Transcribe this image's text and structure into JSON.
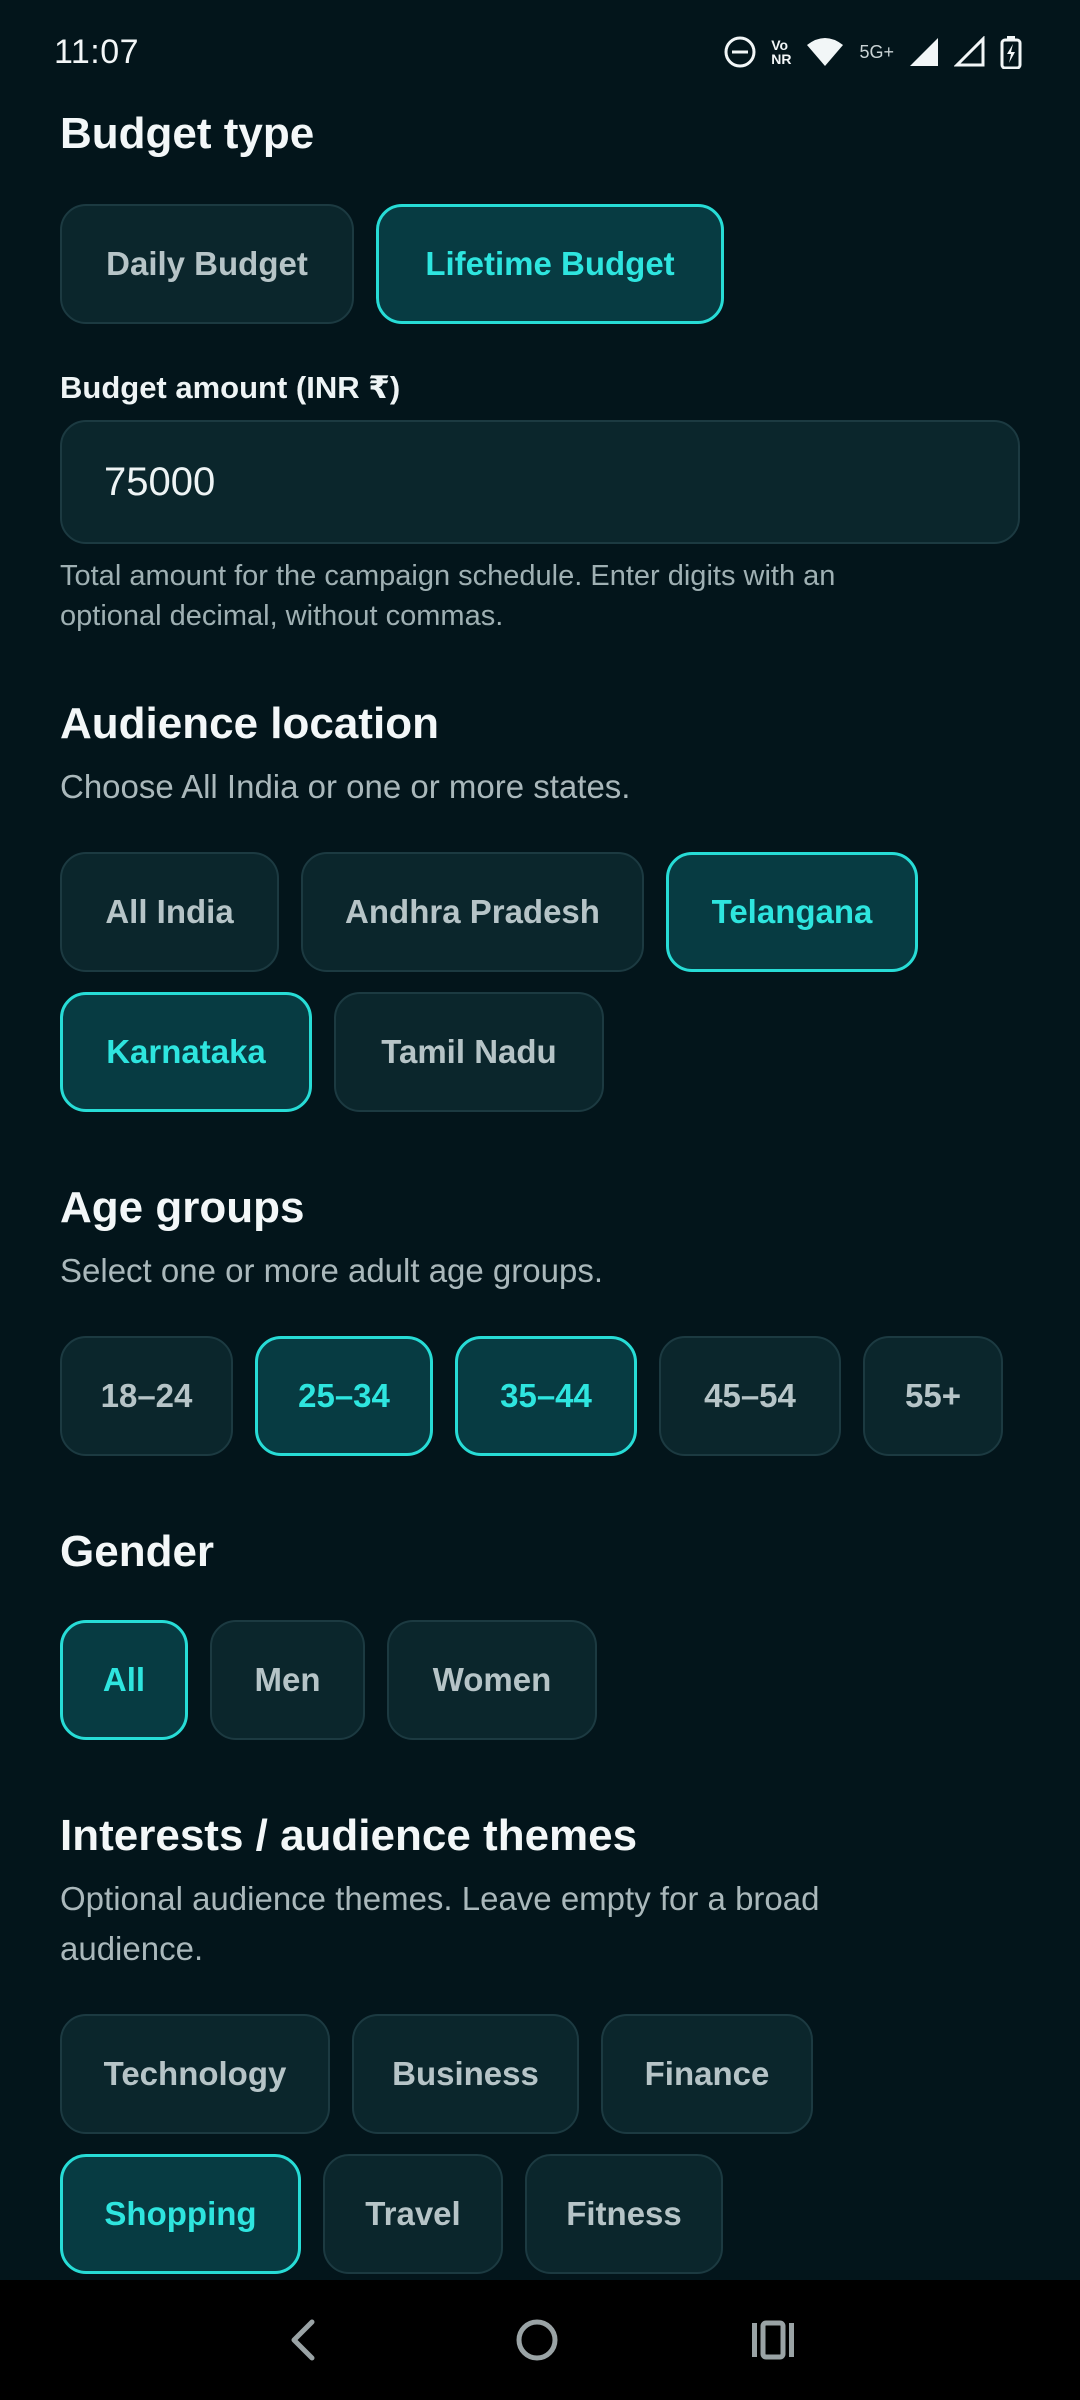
{
  "status_bar": {
    "time": "11:07",
    "vonr_top": "Vo",
    "vonr_bottom": "NR",
    "network": "5G+"
  },
  "budget_type": {
    "title": "Budget type",
    "options": [
      {
        "label": "Daily Budget",
        "selected": false
      },
      {
        "label": "Lifetime Budget",
        "selected": true
      }
    ]
  },
  "budget_amount": {
    "label": "Budget amount (INR ₹)",
    "value": "75000",
    "helper_line1": "Total amount for the campaign schedule. Enter digits with an",
    "helper_line2": "optional decimal, without commas."
  },
  "audience_location": {
    "title": "Audience location",
    "helper": "Choose All India or one or more states.",
    "options": [
      {
        "label": "All India",
        "selected": false
      },
      {
        "label": "Andhra Pradesh",
        "selected": false
      },
      {
        "label": "Telangana",
        "selected": true
      },
      {
        "label": "Karnataka",
        "selected": true
      },
      {
        "label": "Tamil Nadu",
        "selected": false
      }
    ]
  },
  "age_groups": {
    "title": "Age groups",
    "helper": "Select one or more adult age groups.",
    "options": [
      {
        "label": "18–24",
        "selected": false
      },
      {
        "label": "25–34",
        "selected": true
      },
      {
        "label": "35–44",
        "selected": true
      },
      {
        "label": "45–54",
        "selected": false
      },
      {
        "label": "55+",
        "selected": false
      }
    ]
  },
  "gender": {
    "title": "Gender",
    "options": [
      {
        "label": "All",
        "selected": true
      },
      {
        "label": "Men",
        "selected": false
      },
      {
        "label": "Women",
        "selected": false
      }
    ]
  },
  "interests": {
    "title": "Interests / audience themes",
    "helper_line1": "Optional audience themes. Leave empty for a broad",
    "helper_line2": "audience.",
    "options": [
      {
        "label": "Technology",
        "selected": false
      },
      {
        "label": "Business",
        "selected": false
      },
      {
        "label": "Finance",
        "selected": false
      },
      {
        "label": "Shopping",
        "selected": true
      },
      {
        "label": "Travel",
        "selected": false
      },
      {
        "label": "Fitness",
        "selected": false
      }
    ]
  },
  "colors": {
    "background": "#03151b",
    "accent": "#2ee5df",
    "chip_bg": "#0b262c"
  }
}
